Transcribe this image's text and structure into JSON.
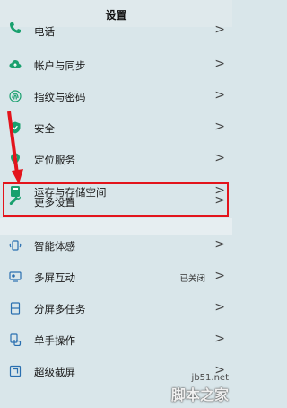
{
  "header": {
    "title": "设置"
  },
  "rows": [
    {
      "label": "电话",
      "icon": "phone-icon",
      "chevron": ">"
    },
    {
      "label": "帐户与同步",
      "icon": "cloud-icon",
      "chevron": ">"
    },
    {
      "label": "指纹与密码",
      "icon": "fingerprint-icon",
      "chevron": ">"
    },
    {
      "label": "安全",
      "icon": "shield-icon",
      "chevron": ">"
    },
    {
      "label": "定位服务",
      "icon": "location-icon",
      "chevron": ">"
    },
    {
      "label": "运存与存储空间",
      "icon": "storage-icon",
      "chevron": ">"
    },
    {
      "label": "更多设置",
      "icon": "wrench-icon",
      "chevron": ">"
    },
    {
      "label": "智能体感",
      "icon": "motion-icon",
      "chevron": ">"
    },
    {
      "label": "多屏互动",
      "icon": "multiscreen-icon",
      "status": "已关闭",
      "chevron": ">"
    },
    {
      "label": "分屏多任务",
      "icon": "splitscreen-icon",
      "chevron": ">"
    },
    {
      "label": "单手操作",
      "icon": "one-hand-icon",
      "chevron": ">"
    },
    {
      "label": "超级截屏",
      "icon": "screenshot-icon",
      "chevron": ">"
    }
  ],
  "watermark": {
    "site": "jb51.net",
    "brand": "脚本之家"
  },
  "colors": {
    "accent": "#19a06e",
    "highlight": "#e3141c"
  }
}
